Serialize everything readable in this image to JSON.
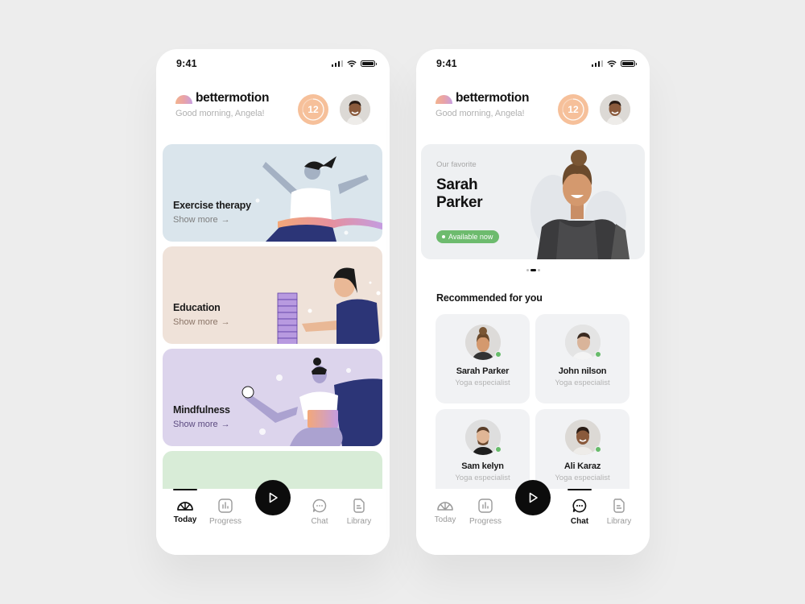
{
  "status_bar": {
    "time": "9:41"
  },
  "brand": {
    "name": "bettermotion",
    "greeting": "Good morning, Angela!"
  },
  "streak": {
    "value": "12",
    "progress_fraction": 0.7
  },
  "colors": {
    "background": "#ededed",
    "streak": "#f6c09a",
    "exercise_card": "#dae5ec",
    "education_card": "#efe2d9",
    "mindfulness_card": "#dcd4ec",
    "next_card": "#d8ecd7",
    "available_badge": "#6dbb6e",
    "online": "#67bb6a"
  },
  "today_screen": {
    "categories": [
      {
        "title": "Exercise therapy",
        "link": "Show more",
        "arrow": "→"
      },
      {
        "title": "Education",
        "link": "Show more",
        "arrow": "→"
      },
      {
        "title": "Mindfulness",
        "link": "Show more",
        "arrow": "→"
      }
    ]
  },
  "chat_screen": {
    "hero": {
      "eyebrow": "Our favorite",
      "first_name": "Sarah",
      "last_name": "Parker",
      "badge": "Available now",
      "carousel_active_index": 1,
      "carousel_count": 3
    },
    "section_title": "Recommended for you",
    "coaches": [
      {
        "name": "Sarah Parker",
        "role": "Yoga especialist",
        "online": true
      },
      {
        "name": "John nilson",
        "role": "Yoga especialist",
        "online": true
      },
      {
        "name": "Sam kelyn",
        "role": "Yoga especialist",
        "online": true
      },
      {
        "name": "Ali Karaz",
        "role": "Yoga especialist",
        "online": true
      }
    ]
  },
  "tabbar": {
    "tabs": [
      {
        "label": "Today",
        "icon": "gauge-icon"
      },
      {
        "label": "Progress",
        "icon": "bar-chart-icon"
      },
      {
        "label": "Chat",
        "icon": "chat-bubble-icon"
      },
      {
        "label": "Library",
        "icon": "document-icon"
      }
    ],
    "play_icon": "play-icon",
    "left_active": "Today",
    "right_active": "Chat"
  }
}
